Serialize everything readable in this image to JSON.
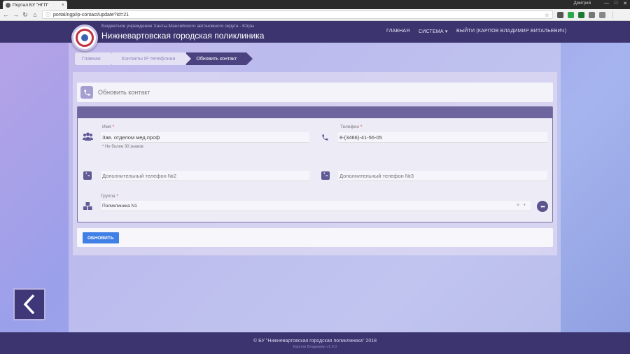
{
  "browser": {
    "tab_title": "Портал БУ \"НГП\"",
    "tab_close": "×",
    "user": "Дмитрий",
    "url": "portal/ngp/ip-contact/update?id=21",
    "win_controls": [
      "—",
      "□",
      "✕"
    ]
  },
  "header": {
    "subtitle": "Бюджетное учреждение Ханты-Мансийского автономного округа - Югры",
    "brand": "Нижневартовская городская поликлиника",
    "nav": {
      "home": "ГЛАВНАЯ",
      "system": "СИСТЕМА ▾",
      "logout": "ВЫЙТИ (КАРПОВ ВЛАДИМИР ВИТАЛЬЕВИЧ)"
    }
  },
  "breadcrumb": [
    "Главная",
    "Контакты IP телефонии",
    "Обновить контакт"
  ],
  "page": {
    "title": "Обновить контакт"
  },
  "form": {
    "name": {
      "label": "Имя",
      "required": "*",
      "value": "Зав. отделом мед.проф",
      "hint": "* Не более 30 знаков"
    },
    "phone": {
      "label": "Телефон",
      "required": "*",
      "value": "8-(3466)-41-56-05"
    },
    "phone2": {
      "placeholder": "Дополнительный телефон №2"
    },
    "phone3": {
      "placeholder": "Дополнительный телефон №3"
    },
    "group": {
      "label": "Группа",
      "required": "*",
      "value": "Поликлиника N1",
      "clear": "×",
      "caret": "▾"
    },
    "submit": "ОБНОВИТЬ"
  },
  "footer": {
    "copyright": "© БУ \"Нижневартовская городская поликлиника\" 2018",
    "version": "Карпов Владимир    v1.0.0"
  },
  "colors": {
    "header": "#3b346e",
    "accent": "#3f7fe6",
    "form_head": "#6e659f"
  }
}
